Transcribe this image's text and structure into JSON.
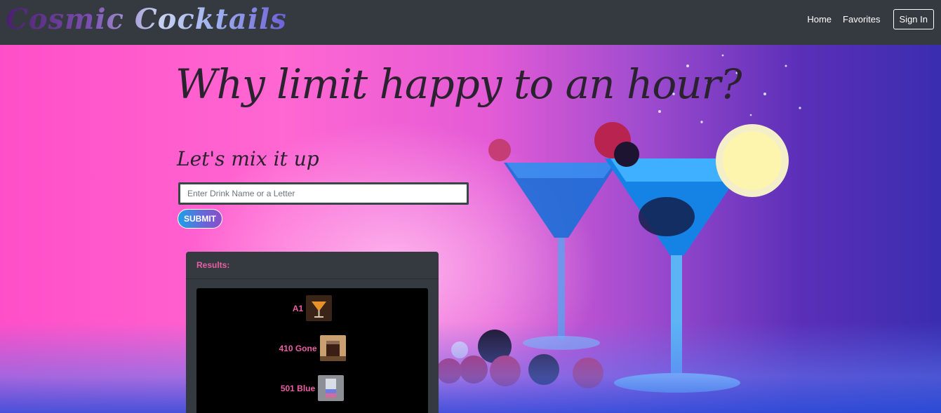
{
  "brand": "Cosmic Cocktails",
  "nav": {
    "home": "Home",
    "favorites": "Favorites",
    "sign_in": "Sign In"
  },
  "hero": {
    "headline": "Why limit happy to an hour?",
    "subhead": "Let's mix it up",
    "search": {
      "placeholder": "Enter Drink Name or a Letter",
      "value": ""
    },
    "submit_label": "SUBMIT"
  },
  "results": {
    "header": "Results:",
    "items": [
      {
        "name": "A1"
      },
      {
        "name": "410 Gone"
      },
      {
        "name": "501 Blue"
      }
    ]
  },
  "colors": {
    "accent_pink": "#e85fa4",
    "navbar": "#343a40",
    "submit_gradient_start": "#1ea0e8",
    "submit_gradient_end": "#8a4ec8"
  }
}
